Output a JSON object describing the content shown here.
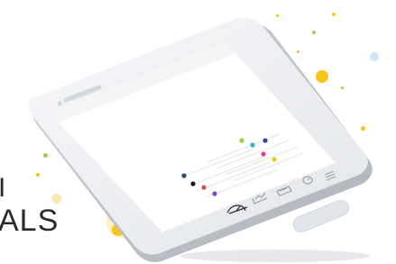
{
  "background_text": {
    "line1": "I",
    "line2": "ALS"
  },
  "bottom_nav": {
    "items": [
      {
        "id": "speed",
        "icon": "speedometer-icon"
      },
      {
        "id": "stats",
        "icon": "line-chart-icon"
      },
      {
        "id": "cards",
        "icon": "cards-icon"
      },
      {
        "id": "history",
        "icon": "clock-icon"
      },
      {
        "id": "menu",
        "icon": "menu-icon"
      }
    ],
    "active": "speed"
  },
  "chart_sliders": {
    "colors": [
      "#2e4a86",
      "#1b1b1b",
      "#e0523a",
      "#7a49c9",
      "#f2c521",
      "#9ad04b",
      "#36b4c7",
      "#e23c8b"
    ]
  },
  "colors": {
    "accent_yellow": "#f5c518",
    "confetti_green": "#9ad04b",
    "confetti_blue": "#9cc9e8",
    "phone_body": "#eef0f3",
    "screen": "#ffffff"
  }
}
